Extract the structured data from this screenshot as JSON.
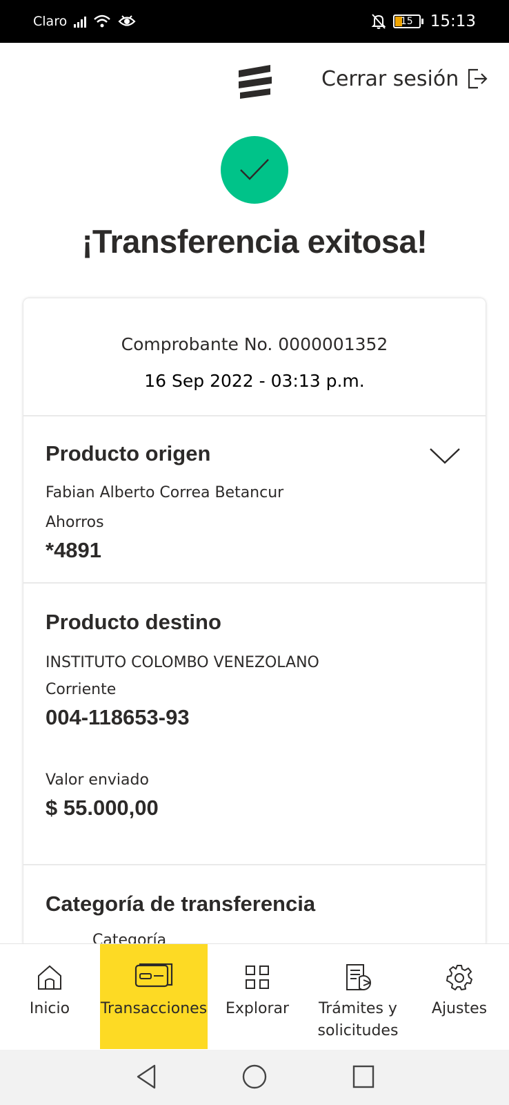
{
  "status_bar": {
    "carrier": "Claro",
    "battery": "15",
    "time": "15:13"
  },
  "header": {
    "logo_icon": "bancolombia-logo-icon",
    "logout_label": "Cerrar sesión"
  },
  "success": {
    "icon": "check-icon",
    "icon_color": "#00c389",
    "title": "¡Transferencia exitosa!"
  },
  "receipt": {
    "number": "Comprobante No. 0000001352",
    "date": "16 Sep 2022 - 03:13 p.m."
  },
  "origin": {
    "title": "Producto origen",
    "holder": "Fabian Alberto Correa Betancur",
    "account_type": "Ahorros",
    "account_number": "*4891"
  },
  "destination": {
    "title": "Producto destino",
    "holder": "INSTITUTO COLOMBO VENEZOLANO",
    "account_type": "Corriente",
    "account_number": "004-118653-93",
    "amount_label": "Valor enviado",
    "amount": "$ 55.000,00"
  },
  "category": {
    "title": "Categoría de transferencia",
    "label": "Categoría"
  },
  "bottom_nav": {
    "active_color": "#fdda24",
    "items": [
      {
        "label": "Inicio",
        "icon": "home-icon"
      },
      {
        "label": "Transacciones",
        "icon": "card-icon",
        "active": true
      },
      {
        "label": "Explorar",
        "icon": "grid-icon"
      },
      {
        "label": "Trámites y solicitudes",
        "icon": "document-icon"
      },
      {
        "label": "Ajustes",
        "icon": "gear-icon"
      }
    ]
  }
}
